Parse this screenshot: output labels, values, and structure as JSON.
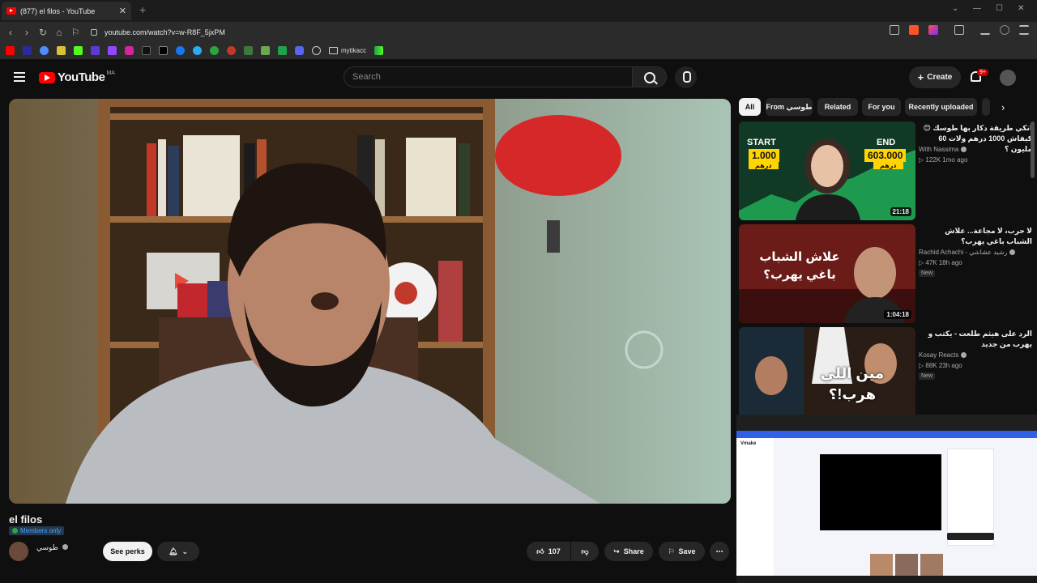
{
  "browser": {
    "tab_title": "(877) el filos - YouTube",
    "tab_close": "✕",
    "new_tab": "+",
    "url": "youtube.com/watch?v=w-R8F_5jxPM",
    "bookmark_folder": "mytikacc"
  },
  "header": {
    "logo_text": "YouTube",
    "country_code": "MA",
    "search_placeholder": "Search",
    "create_label": "Create",
    "notification_count": "9+"
  },
  "video": {
    "title": "el filos",
    "members_badge": "Members only",
    "channel_name": "طوسي",
    "see_perks": "See perks",
    "likes": "107",
    "share_label": "Share",
    "save_label": "Save"
  },
  "chips": [
    "All",
    "From طوسي",
    "Related",
    "For you",
    "Recently uploaded"
  ],
  "recommendations": [
    {
      "title": "انكي طريقة دكار بها طوسك 😊 كيفاش 1000 درهم ولات 60 مليون ؟",
      "channel": "With Nassima",
      "meta": "▷ 122K  1mo ago",
      "duration": "21:18",
      "thumb_start_label": "START",
      "thumb_start_value": "1.000",
      "thumb_start_unit": "درهم",
      "thumb_end_label": "END",
      "thumb_end_value": "603.000",
      "thumb_end_unit": "درهم",
      "badge": ""
    },
    {
      "title": "لا حرب، لا مجاعة... علاش الشباب باغي يهرب؟",
      "channel": "Rachid Achachi - رشيد عشاشي",
      "meta": "▷ 47K  18h ago",
      "duration": "1:04:18",
      "thumb_text": "علاش الشباب باغي يهرب؟",
      "badge": "New"
    },
    {
      "title": "الرد على هيثم طلعت - يكتب و يهرب من جديد",
      "channel": "Kosay Reacts",
      "meta": "▷ 88K  23h ago",
      "duration": "",
      "thumb_text": "مين اللي هرب!؟",
      "badge": "New"
    }
  ],
  "mini_window": {
    "app_name": "Vmake"
  },
  "colors": {
    "bg": "#0f0f0f",
    "youtube_red": "#ff0000",
    "members_green": "#2ba640",
    "chip_bg": "#272727"
  }
}
